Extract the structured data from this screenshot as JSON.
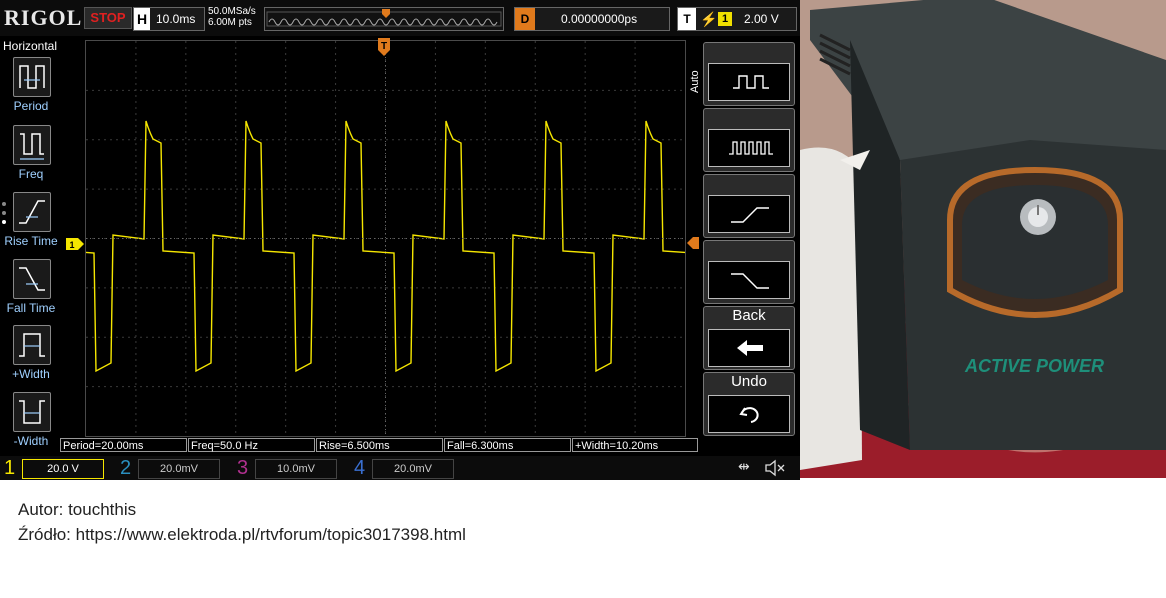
{
  "scope": {
    "brand": "RIGOL",
    "run_state": "STOP",
    "horizontal": {
      "label": "H",
      "timebase": "10.0ms"
    },
    "sample_rate": "50.0MSa/s",
    "memory_depth": "6.00M pts",
    "delay": {
      "label": "D",
      "value": "0.00000000ps"
    },
    "trigger": {
      "label": "T",
      "source": "1",
      "level": "2.00 V"
    },
    "left_menu": {
      "title": "Horizontal",
      "items": [
        {
          "label": "Period",
          "icon": "period-icon"
        },
        {
          "label": "Freq",
          "icon": "frequency-icon"
        },
        {
          "label": "Rise Time",
          "icon": "rise-time-icon"
        },
        {
          "label": "Fall Time",
          "icon": "fall-time-icon"
        },
        {
          "label": "+Width",
          "icon": "positive-width-icon"
        },
        {
          "label": "-Width",
          "icon": "negative-width-icon"
        }
      ]
    },
    "right_menu": {
      "auto_label": "Auto",
      "back_label": "Back",
      "undo_label": "Undo",
      "trigger_type_icons": [
        "square-wave-icon",
        "pulse-train-icon",
        "rising-edge-icon",
        "falling-edge-icon"
      ]
    },
    "measurements": [
      {
        "text": "Period=20.00ms"
      },
      {
        "text": "Freq=50.0 Hz"
      },
      {
        "text": "Rise=6.500ms"
      },
      {
        "text": "Fall=6.300ms"
      },
      {
        "text": "+Width=10.20ms"
      }
    ],
    "channels": [
      {
        "number": "1",
        "scale": "20.0 V",
        "color": "#f5e600",
        "active": true
      },
      {
        "number": "2",
        "scale": "20.0mV",
        "color": "#2a8fbf",
        "active": false
      },
      {
        "number": "3",
        "scale": "10.0mV",
        "color": "#b0308f",
        "active": false
      },
      {
        "number": "4",
        "scale": "20.0mV",
        "color": "#3a6fd0",
        "active": false
      }
    ],
    "waveform": {
      "channel": "1",
      "color": "#f5e600",
      "shape": "modified-sine (stepped square)",
      "period_ms": 20.0,
      "cycles_visible": 6
    },
    "marker_color": "#e07a1c"
  },
  "photo": {
    "brand_text": "ACTIVE POWER"
  },
  "caption": {
    "author": "Autor: touchthis",
    "source": "Źródło: https://www.elektroda.pl/rtvforum/topic3017398.html"
  }
}
